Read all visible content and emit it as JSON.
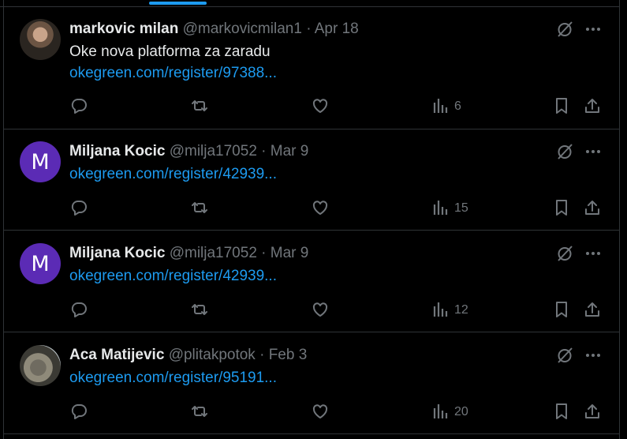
{
  "theme": {
    "background": "#000000",
    "accent": "#1d9bf0",
    "muted": "#71767b",
    "text": "#e7e9ea"
  },
  "tweets": [
    {
      "name": "markovic milan",
      "handle": "@markovicmilan1",
      "sep": "·",
      "date": "Apr 18",
      "text": "Oke nova platforma za zaradu",
      "link": "okegreen.com/register/97388...",
      "views": "6",
      "avatar": "photo"
    },
    {
      "name": "Miljana Kocic",
      "handle": "@milja17052",
      "sep": "·",
      "date": "Mar 9",
      "text": "",
      "link": "okegreen.com/register/42939...",
      "views": "15",
      "avatar_letter": "M"
    },
    {
      "name": "Miljana Kocic",
      "handle": "@milja17052",
      "sep": "·",
      "date": "Mar 9",
      "text": "",
      "link": "okegreen.com/register/42939...",
      "views": "12",
      "avatar_letter": "M"
    },
    {
      "name": "Aca Matijevic",
      "handle": "@plitakpotok",
      "sep": "·",
      "date": "Feb 3",
      "text": "",
      "link": "okegreen.com/register/95191...",
      "views": "20",
      "avatar": "photo"
    }
  ],
  "icons": [
    "grok-icon",
    "more-icon",
    "reply-icon",
    "retweet-icon",
    "like-icon",
    "views-icon",
    "bookmark-icon",
    "share-icon"
  ]
}
